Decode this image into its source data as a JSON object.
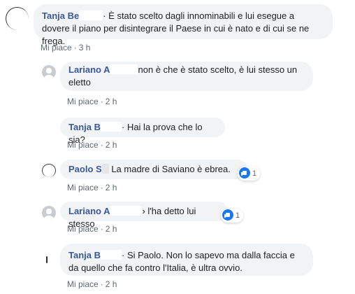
{
  "comments": [
    {
      "author": "Tanja Be",
      "text": "· È stato scelto dagli innominabili e lui esegue a dovere il piano per disintegrare il Paese in cui è nato e di cui se ne frega.",
      "like_label": "Mi piace",
      "time": "3 h"
    },
    {
      "author": "Lariano A",
      "text": "non è che è stato scelto, è lui stesso un eletto",
      "like_label": "Mi piace",
      "time": "2 h"
    },
    {
      "author": "Tanja B",
      "text": "· Hai la prova che lo sia?",
      "like_label": "Mi piace",
      "time": "2 h"
    },
    {
      "author": "Paolo S",
      "text": "La madre di Saviano è ebrea.",
      "like_label": "Mi piace",
      "time": "2 h",
      "reaction_count": "1"
    },
    {
      "author": "Lariano A",
      "text": "› l'ha detto lui stesso",
      "like_label": "Mi piace",
      "time": "2 h",
      "reaction_count": "1"
    },
    {
      "author": "Tanja B",
      "text": "· Si Paolo. Non lo sapevo ma dalla faccia e da quello che fa contro l'Italia, è ultra ovvio.",
      "like_label": "Mi piace",
      "time": "2 h"
    }
  ],
  "colors": {
    "author": "#385898",
    "bubble": "#f2f3f5",
    "meta": "#606770",
    "like": "#1877f2"
  }
}
